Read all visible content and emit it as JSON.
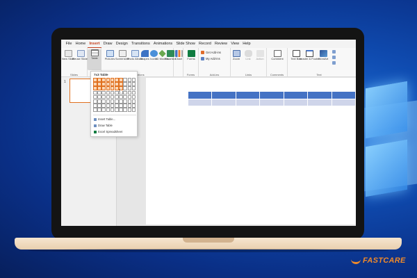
{
  "ribbon": {
    "tabs": [
      "File",
      "Home",
      "Insert",
      "Draw",
      "Design",
      "Transitions",
      "Animations",
      "Slide Show",
      "Record",
      "Review",
      "View",
      "Help"
    ],
    "active_tab": "Insert",
    "groups": {
      "slides": "Slides",
      "illustrations": "Illustrations",
      "forms": "Forms",
      "addins": "Add-ins",
      "links": "Links",
      "comments": "Comments",
      "text": "Text"
    },
    "buttons": {
      "new_slide": "New Slide",
      "reuse_slides": "Reuse Slides",
      "table": "Table",
      "pictures": "Pictures",
      "screenshot": "Screenshot",
      "photo_album": "Photo Album",
      "shapes": "Shapes",
      "icons": "Icons",
      "models_3d": "3D Models",
      "smartart": "SmartArt",
      "chart": "Chart",
      "forms": "Forms",
      "get_addins": "Get Add-ins",
      "my_addins": "My Add-ins",
      "zoom": "Zoom",
      "link": "Link",
      "action": "Action",
      "comment": "Comment",
      "text_box": "Text Box",
      "header_footer": "Header & Footer",
      "wordart": "WordArt"
    }
  },
  "thumbnails": {
    "slide_number": "1"
  },
  "table_dropdown": {
    "title": "7x3 Table",
    "grid_cols": 10,
    "grid_rows": 8,
    "selected_cols": 7,
    "selected_rows": 3,
    "items": [
      "Insert Table...",
      "Draw Table",
      "Excel Spreadsheet"
    ]
  },
  "slide_table": {
    "cols": 7,
    "rows": 2
  },
  "brand": {
    "name": "FASTCARE"
  },
  "colors": {
    "accent": "#c43e1c",
    "selection": "#e0701f",
    "table_header": "#4472c4",
    "table_row": "#cfd5ea",
    "brand": "#f08a2a"
  }
}
